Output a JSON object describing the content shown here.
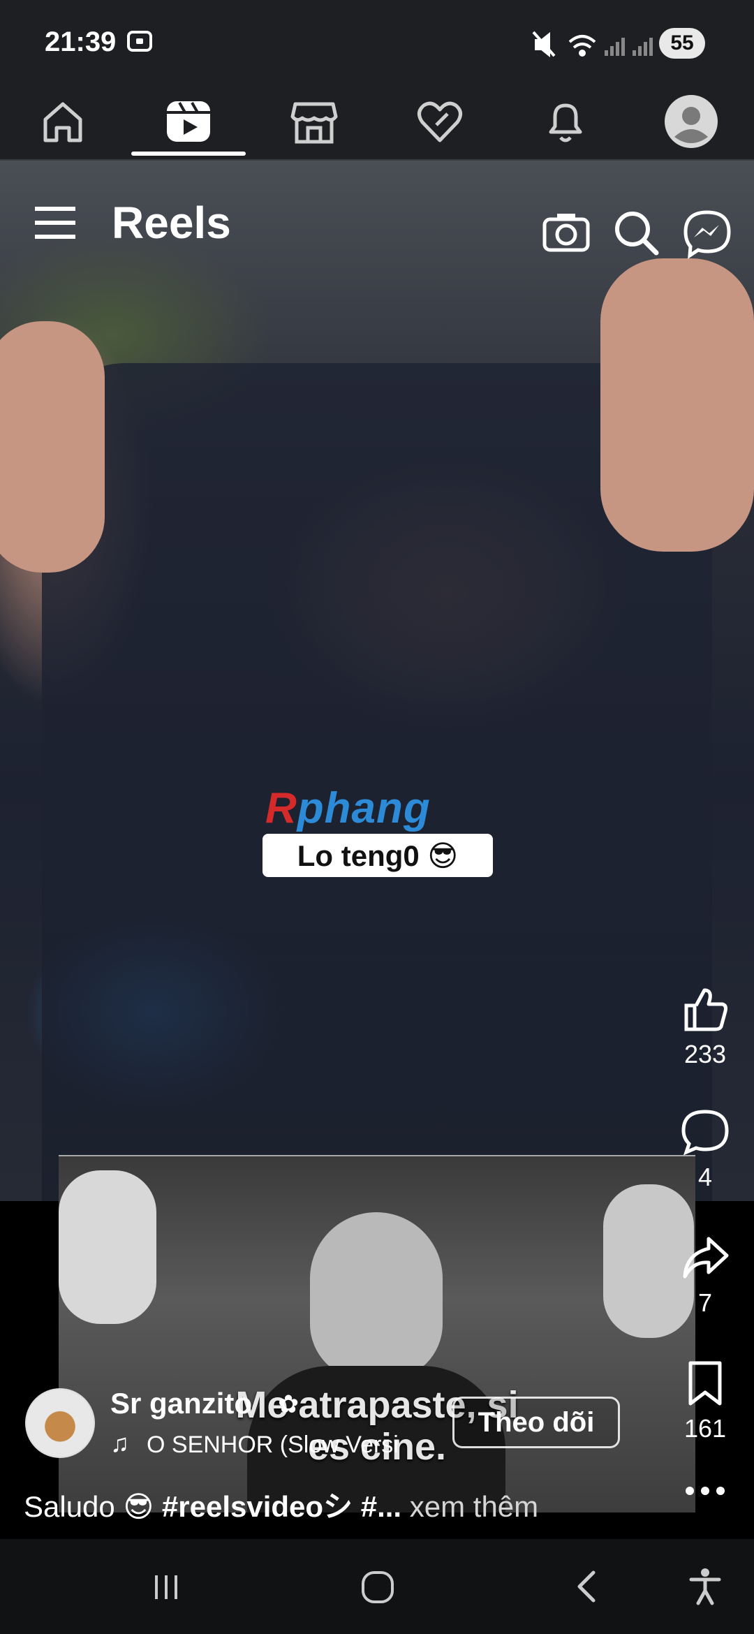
{
  "status_bar": {
    "time": "21:39",
    "battery": "55"
  },
  "nav": {
    "active_tab": "reels"
  },
  "reels": {
    "title": "Reels",
    "watermark": "Rphang",
    "watermark_first": "R",
    "watermark_rest": "phang",
    "sticker_text": "Lo teng0 😎",
    "meme_text_line1": "Me atrapaste, si",
    "meme_text_line2": "es cine."
  },
  "actions": {
    "likes": "233",
    "comments": "4",
    "shares": "7",
    "saves": "161"
  },
  "post": {
    "author": "Sr ganzito",
    "song": "O SENHOR (Slow Versi",
    "follow_label": "Theo dõi",
    "caption_text": "Saludo 😎 ",
    "caption_tags": "#reelsvideoシ #...",
    "more_label": " xem thêm"
  },
  "colors": {
    "accent_blue": "#2c8ad6",
    "status_bg": "#1e1f22"
  }
}
